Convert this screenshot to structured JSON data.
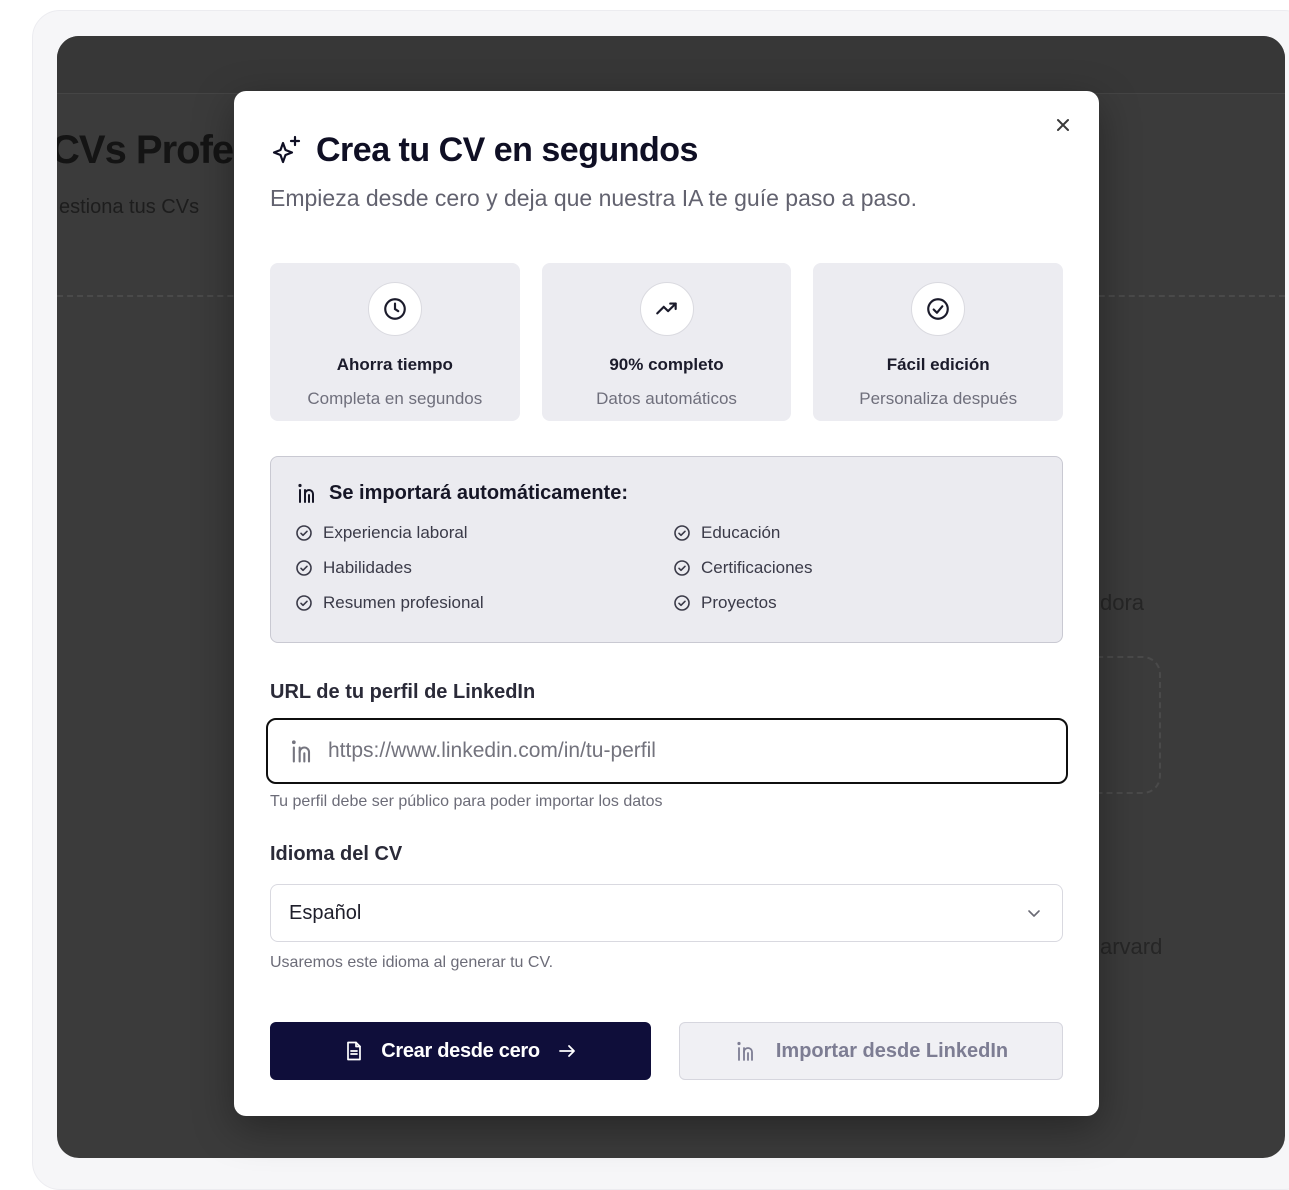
{
  "background": {
    "title_fragment": "CVs Profe",
    "subtitle_fragment": "estiona tus CVs",
    "peek_text_1": "dora",
    "peek_text_2": "arvard"
  },
  "modal": {
    "title": "Crea tu CV en segundos",
    "title_icon": "sparkles-icon",
    "subtitle": "Empieza desde cero y deja que nuestra IA te guíe paso a paso.",
    "close_icon": "close-icon",
    "features": [
      {
        "icon": "clock-icon",
        "title": "Ahorra tiempo",
        "description": "Completa en segundos"
      },
      {
        "icon": "trending-up-icon",
        "title": "90% completo",
        "description": "Datos automáticos"
      },
      {
        "icon": "check-circle-icon",
        "title": "Fácil edición",
        "description": "Personaliza después"
      }
    ],
    "import_box": {
      "icon": "linkedin-icon",
      "title": "Se importará automáticamente:",
      "items": [
        "Experiencia laboral",
        "Educación",
        "Habilidades",
        "Certificaciones",
        "Resumen profesional",
        "Proyectos"
      ]
    },
    "url_field": {
      "label": "URL de tu perfil de LinkedIn",
      "placeholder": "https://www.linkedin.com/in/tu-perfil",
      "value": "",
      "hint": "Tu perfil debe ser público para poder importar los datos"
    },
    "language_field": {
      "label": "Idioma del CV",
      "selected": "Español",
      "hint": "Usaremos este idioma al generar tu CV."
    },
    "buttons": {
      "primary_label": "Crear desde cero",
      "secondary_label": "Importar desde LinkedIn"
    }
  },
  "colors": {
    "primary_button": "#0f0e3a",
    "overlay": "#3b3b3b",
    "feature_bg": "#ececf1"
  }
}
